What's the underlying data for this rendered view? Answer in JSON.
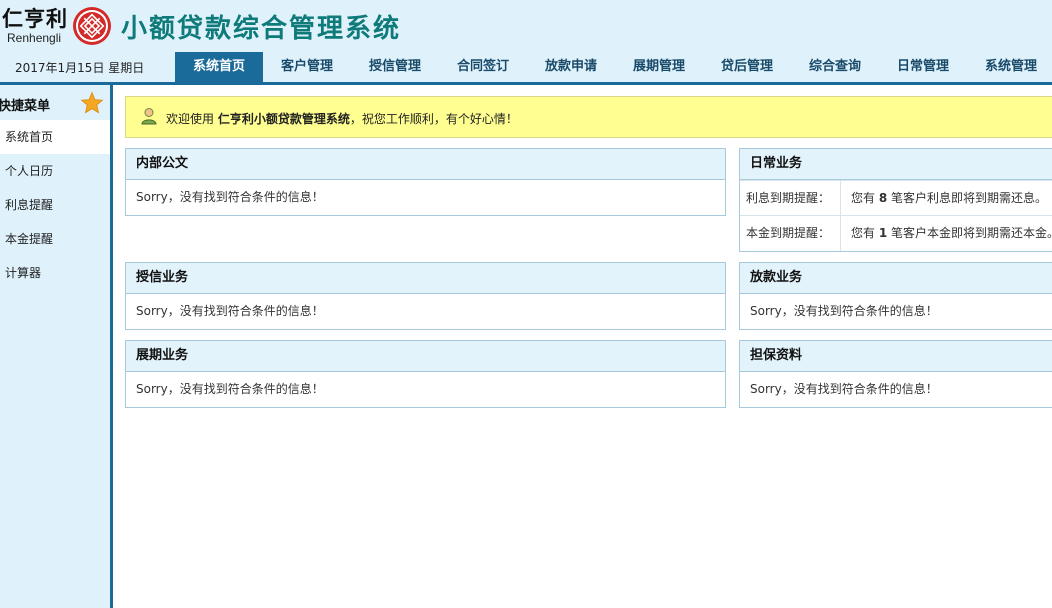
{
  "header": {
    "logo_cn": "仁亨利",
    "logo_en": "Renhengli",
    "app_title": "小额贷款综合管理系统",
    "date": "2017年1月15日 星期日"
  },
  "nav": {
    "items": [
      {
        "label": "系统首页",
        "active": true
      },
      {
        "label": "客户管理"
      },
      {
        "label": "授信管理"
      },
      {
        "label": "合同签订"
      },
      {
        "label": "放款申请"
      },
      {
        "label": "展期管理"
      },
      {
        "label": "贷后管理"
      },
      {
        "label": "综合查询"
      },
      {
        "label": "日常管理"
      },
      {
        "label": "系统管理"
      }
    ]
  },
  "sidebar": {
    "title": "快捷菜单",
    "items": [
      {
        "label": "系统首页",
        "active": true
      },
      {
        "label": "个人日历"
      },
      {
        "label": "利息提醒"
      },
      {
        "label": "本金提醒"
      },
      {
        "label": "计算器"
      }
    ]
  },
  "welcome": {
    "prefix": "欢迎使用",
    "system_name": "仁亨利小额贷款管理系统",
    "suffix": "，祝您工作顺利，有个好心情！"
  },
  "panels": {
    "notice": {
      "title": "内部公文",
      "empty": "Sorry，没有找到符合条件的信息！"
    },
    "daily": {
      "title": "日常业务",
      "rows": [
        {
          "label": "利息到期提醒：",
          "pre": "您有",
          "count": "8",
          "post": "笔客户利息即将到期需还息。"
        },
        {
          "label": "本金到期提醒：",
          "pre": "您有",
          "count": "1",
          "post": "笔客户本金即将到期需还本金。"
        }
      ]
    },
    "credit": {
      "title": "授信业务",
      "empty": "Sorry，没有找到符合条件的信息！"
    },
    "loan": {
      "title": "放款业务",
      "empty": "Sorry，没有找到符合条件的信息！"
    },
    "extension": {
      "title": "展期业务",
      "empty": "Sorry，没有找到符合条件的信息！"
    },
    "guarantee": {
      "title": "担保资料",
      "empty": "Sorry，没有找到符合条件的信息！"
    }
  },
  "colors": {
    "header_bg": "#dff2fb",
    "accent": "#1a6a9a",
    "title": "#0e7a7a",
    "welcome_bg": "#fefe91",
    "logo_red": "#d42a2a",
    "star": "#f5a623"
  },
  "icons": {
    "logo": "logo-mark-icon",
    "star": "star-icon",
    "user": "user-icon"
  }
}
